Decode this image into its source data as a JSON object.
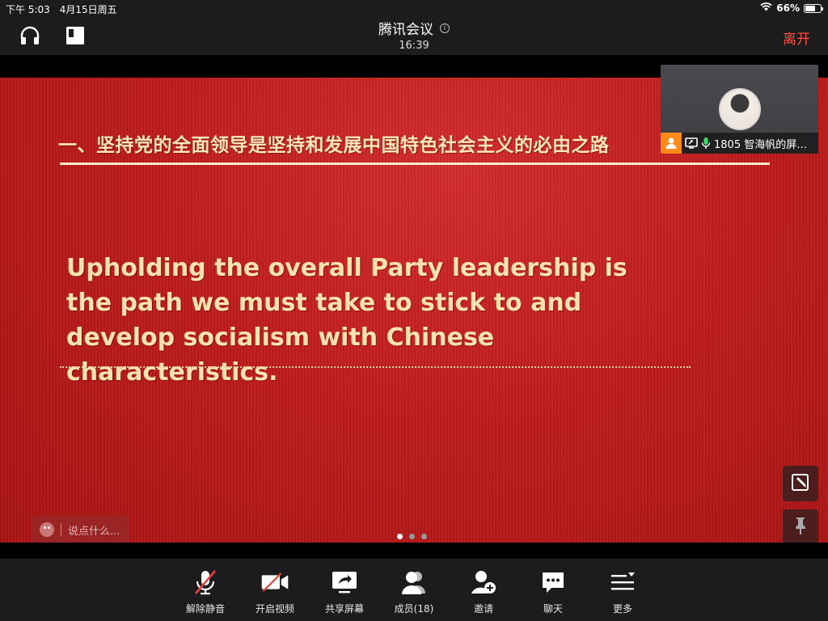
{
  "status_bar": {
    "time": "下午 5:03",
    "date": "4月15日周五",
    "battery_percent": "66%",
    "battery_level": 0.66
  },
  "header": {
    "meeting_title": "腾讯会议",
    "meeting_time": "16:39",
    "leave_label": "离开"
  },
  "slide": {
    "heading": "一、坚持党的全面领导是坚持和发展中国特色社会主义的必由之路",
    "body": "Upholding the overall Party leadership is the path we must take to stick to and develop socialism with Chinese characteristics.",
    "page_count": 3,
    "active_page": 1
  },
  "video_tile": {
    "participant_label": "1805 智海帆的屏…"
  },
  "chat": {
    "placeholder": "说点什么..."
  },
  "toolbar": {
    "unmute_label": "解除静音",
    "start_video_label": "开启视频",
    "share_screen_label": "共享屏幕",
    "members_label": "成员(18)",
    "invite_label": "邀请",
    "chat_label": "聊天",
    "more_label": "更多"
  },
  "colors": {
    "accent_leave": "#ff4d3f",
    "slide_red": "#c01c1c",
    "slide_text": "#f8e2ad",
    "host_badge": "#ff8a1a"
  }
}
